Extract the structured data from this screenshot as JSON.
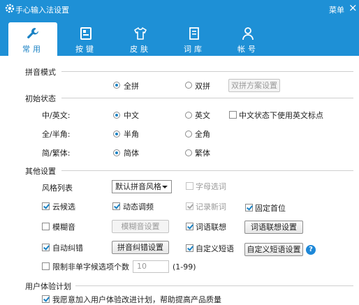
{
  "window": {
    "title": "手心输入法设置",
    "menu_label": "菜单",
    "close_glyph": "×"
  },
  "tabs": [
    {
      "label": "常用",
      "icon": "wrench-icon",
      "active": true
    },
    {
      "label": "按键",
      "icon": "keyboard-icon",
      "active": false
    },
    {
      "label": "皮肤",
      "icon": "shirt-icon",
      "active": false
    },
    {
      "label": "词库",
      "icon": "book-icon",
      "active": false
    },
    {
      "label": "帐号",
      "icon": "user-icon",
      "active": false
    }
  ],
  "pinyin_mode": {
    "section": "拼音模式",
    "options": [
      "全拼",
      "双拼"
    ],
    "selected": "全拼",
    "scheme_button": "双拼方案设置"
  },
  "initial_state": {
    "section": "初始状态",
    "rows": [
      {
        "label": "中/英文:",
        "options": [
          "中文",
          "英文"
        ],
        "selected": "中文",
        "extra_checkbox": "中文状态下使用英文标点"
      },
      {
        "label": "全/半角:",
        "options": [
          "半角",
          "全角"
        ],
        "selected": "半角"
      },
      {
        "label": "简/繁体:",
        "options": [
          "简体",
          "繁体"
        ],
        "selected": "简体"
      }
    ]
  },
  "other": {
    "section": "其他设置",
    "style_label": "风格列表",
    "style_value": "默认拼音风格",
    "char_select": "字母选词",
    "cloud": "云候选",
    "dynamic_freq": "动态调频",
    "record_new": "记录新词",
    "fixed_first": "固定首位",
    "fuzzy": "模糊音",
    "fuzzy_button": "模糊音设置",
    "assoc": "词语联想",
    "assoc_button": "词语联想设置",
    "autocorrect": "自动纠错",
    "correct_button": "拼音纠错设置",
    "custom_phrase": "自定义短语",
    "custom_phrase_button": "自定义短语设置",
    "limit_label": "限制非单字候选项个数",
    "limit_value": "10",
    "limit_range": "(1-99)",
    "help_glyph": "?"
  },
  "ux": {
    "section": "用户体验计划",
    "join_label": "我愿意加入用户体验改进计划，帮助提高产品质量"
  },
  "colors": {
    "titlebar": "#1e90d6",
    "accent": "#1a82c4"
  }
}
